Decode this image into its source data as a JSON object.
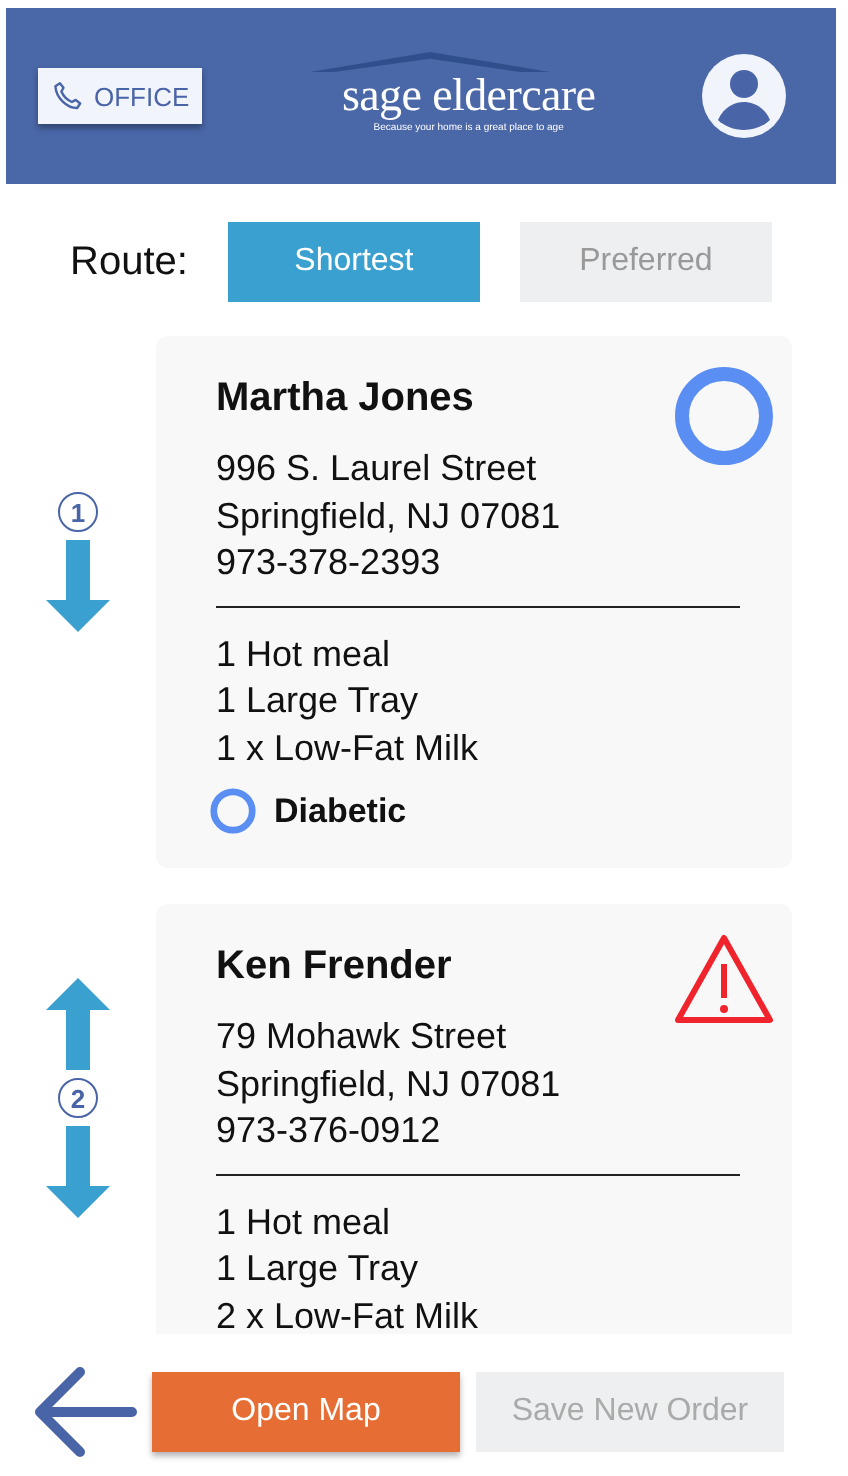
{
  "header": {
    "office_button": "OFFICE",
    "logo": {
      "name": "sage eldercare",
      "tagline": "Because your home is a great place to age"
    }
  },
  "route": {
    "label": "Route:",
    "options": [
      {
        "label": "Shortest",
        "selected": true
      },
      {
        "label": "Preferred",
        "selected": false
      }
    ]
  },
  "stops": [
    {
      "number": "1",
      "move_up": false,
      "move_down": true,
      "name": "Martha Jones",
      "address": [
        "996 S. Laurel Street",
        "Springfield, NJ 07081"
      ],
      "phone": "973-378-2393",
      "items": [
        "1 Hot meal",
        "1 Large Tray",
        "1 x Low-Fat Milk"
      ],
      "kind": "circle",
      "tag": "Diabetic"
    },
    {
      "number": "2",
      "move_up": true,
      "move_down": true,
      "name": "Ken Frender",
      "address": [
        "79 Mohawk Street",
        "Springfield, NJ 07081"
      ],
      "phone": "973-376-0912",
      "items": [
        "1 Hot meal",
        "1 Large Tray",
        "2 x Low-Fat Milk"
      ],
      "kind": "warning"
    }
  ],
  "footer": {
    "primary": "Open Map",
    "secondary": {
      "label": "Save New Order",
      "disabled": true
    }
  }
}
